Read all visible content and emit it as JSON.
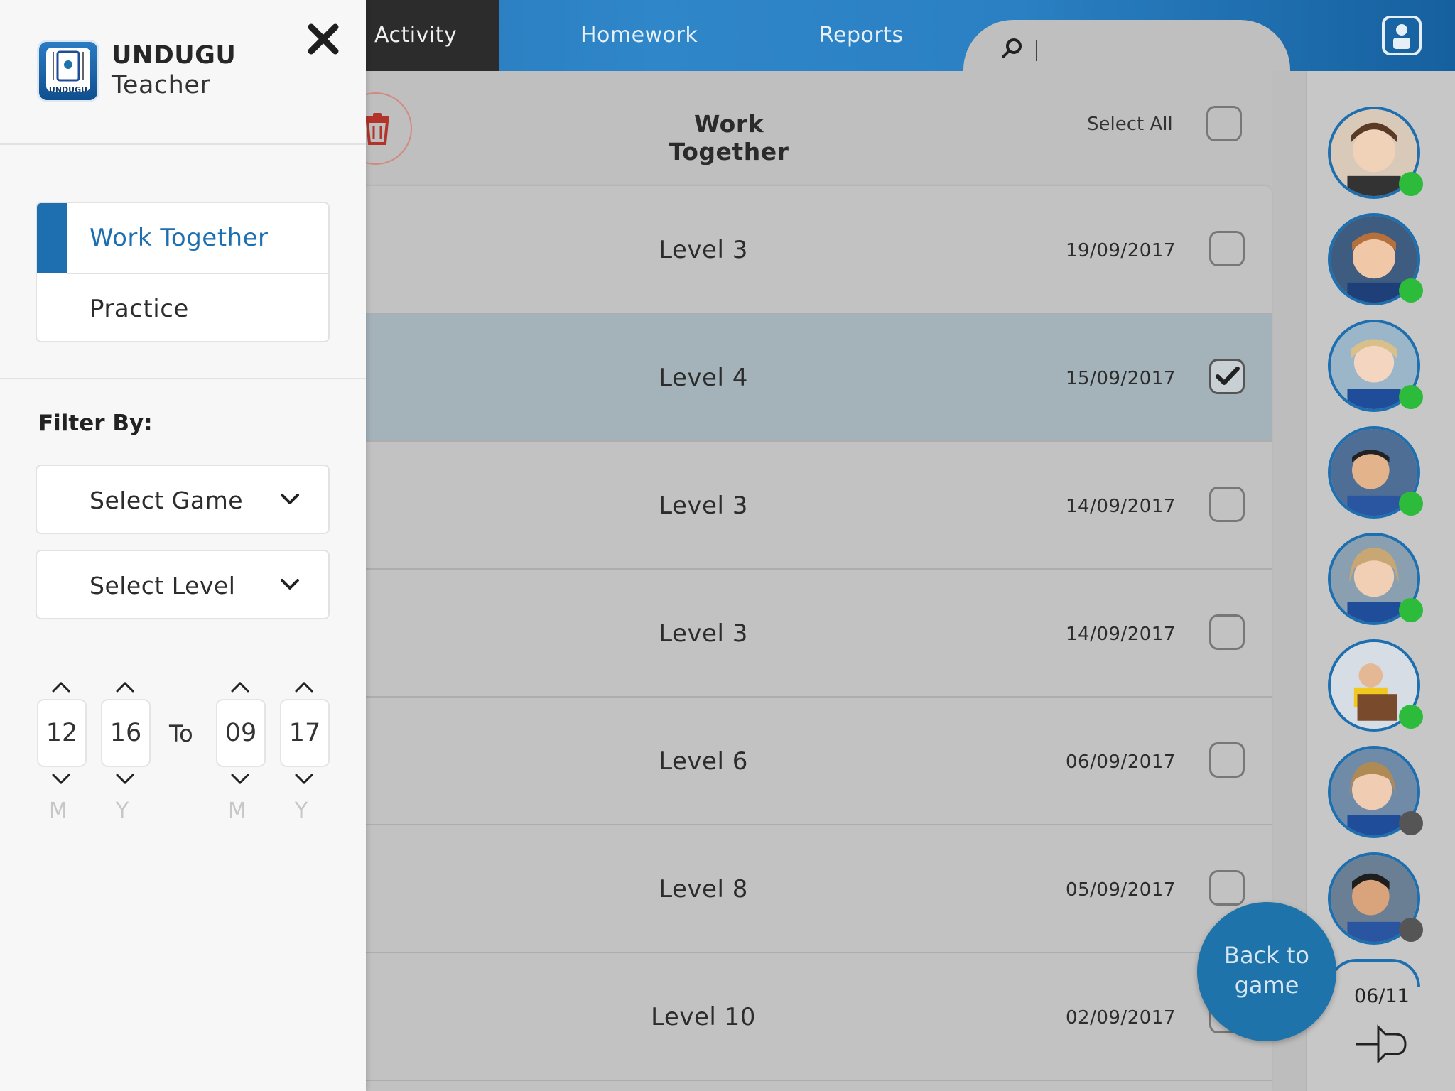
{
  "nav": {
    "tabs": [
      {
        "label": "Activity"
      },
      {
        "label": "Homework"
      },
      {
        "label": "Reports"
      }
    ],
    "search": {
      "icon": "search-icon",
      "value": ""
    },
    "profile_icon": "user-profile-icon"
  },
  "list": {
    "title": "Work Together",
    "select_all_label": "Select All",
    "rows": [
      {
        "level": "Level 3",
        "date": "19/09/2017",
        "checked": false
      },
      {
        "level": "Level 4",
        "date": "15/09/2017",
        "checked": true
      },
      {
        "level": "Level 3",
        "date": "14/09/2017",
        "checked": false
      },
      {
        "level": "Level 3",
        "date": "14/09/2017",
        "checked": false
      },
      {
        "level": "Level 6",
        "date": "06/09/2017",
        "checked": false
      },
      {
        "level": "Level 8",
        "date": "05/09/2017",
        "checked": false
      },
      {
        "level": "Level 10",
        "date": "02/09/2017",
        "checked": false
      }
    ]
  },
  "students": {
    "count": "06/11",
    "avatars": [
      {
        "status": "online"
      },
      {
        "status": "online"
      },
      {
        "status": "online"
      },
      {
        "status": "online"
      },
      {
        "status": "online"
      },
      {
        "status": "online"
      },
      {
        "status": "offline"
      },
      {
        "status": "offline"
      }
    ]
  },
  "back_button": {
    "line1": "Back to",
    "line2": "game"
  },
  "drawer": {
    "app_name": "UNDUGU",
    "app_subtitle": "Teacher",
    "logo_text": "UNDUGU",
    "modes": [
      {
        "label": "Work Together",
        "active": true
      },
      {
        "label": "Practice",
        "active": false
      }
    ],
    "filter_title": "Filter By:",
    "select_game": "Select Game",
    "select_level": "Select Level",
    "date_range": {
      "from_month": "12",
      "from_year": "16",
      "to_label": "To",
      "to_month": "09",
      "to_year": "17",
      "month_unit": "M",
      "year_unit": "Y"
    }
  },
  "colors": {
    "brand_blue": "#1d6fb0",
    "online": "#2cbb3a",
    "offline": "#555555",
    "selected_row": "#a4b2ba"
  }
}
